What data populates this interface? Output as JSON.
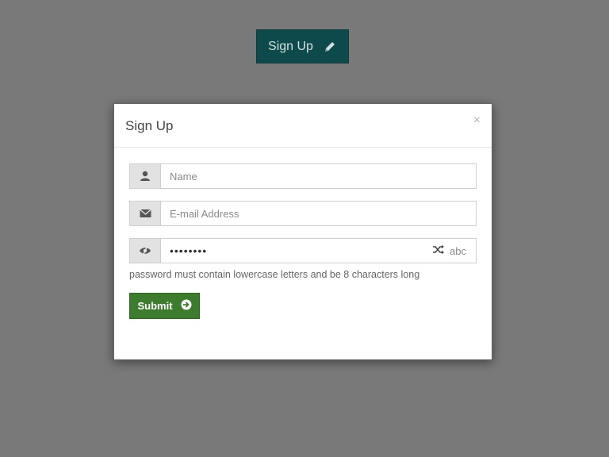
{
  "colors": {
    "backdrop": "#797979",
    "trigger_button_bg": "#0e4a4c",
    "submit_button_bg": "#3d7b2e"
  },
  "trigger_button": {
    "label": "Sign Up",
    "icon": "pencil-icon"
  },
  "modal": {
    "title": "Sign Up",
    "close_label": "×",
    "fields": {
      "name": {
        "placeholder": "Name",
        "icon": "user-icon"
      },
      "email": {
        "placeholder": "E-mail Address",
        "icon": "envelope-icon"
      },
      "password": {
        "value": "••••••••",
        "icon": "eye-slash-icon",
        "generate_icon": "shuffle-icon",
        "toggle_label": "abc"
      }
    },
    "password_hint": "password must contain lowercase letters and be 8 characters long",
    "submit": {
      "label": "Submit",
      "icon": "arrow-circle-right-icon"
    }
  }
}
